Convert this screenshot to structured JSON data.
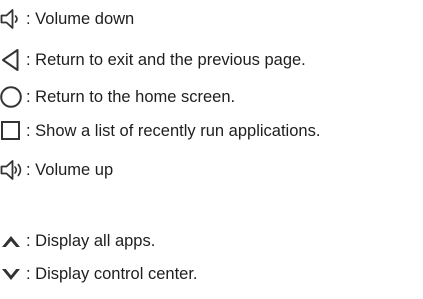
{
  "items": [
    {
      "icon": "volume-down-icon",
      "label": ": Volume down"
    },
    {
      "icon": "back-triangle-icon",
      "label": ": Return to exit and the previous page."
    },
    {
      "icon": "home-circle-icon",
      "label": ": Return to the home screen."
    },
    {
      "icon": "recent-apps-square-icon",
      "label": ": Show a list of recently run applications."
    },
    {
      "icon": "volume-up-icon",
      "label": ": Volume up"
    },
    {
      "icon": "chevron-up-icon",
      "label": ": Display all apps."
    },
    {
      "icon": "chevron-down-icon",
      "label": ": Display control center."
    }
  ],
  "colors": {
    "text": "#1e1e1e",
    "icon_stroke": "#333333",
    "chevron_fill": "#333333",
    "background": "#ffffff"
  }
}
